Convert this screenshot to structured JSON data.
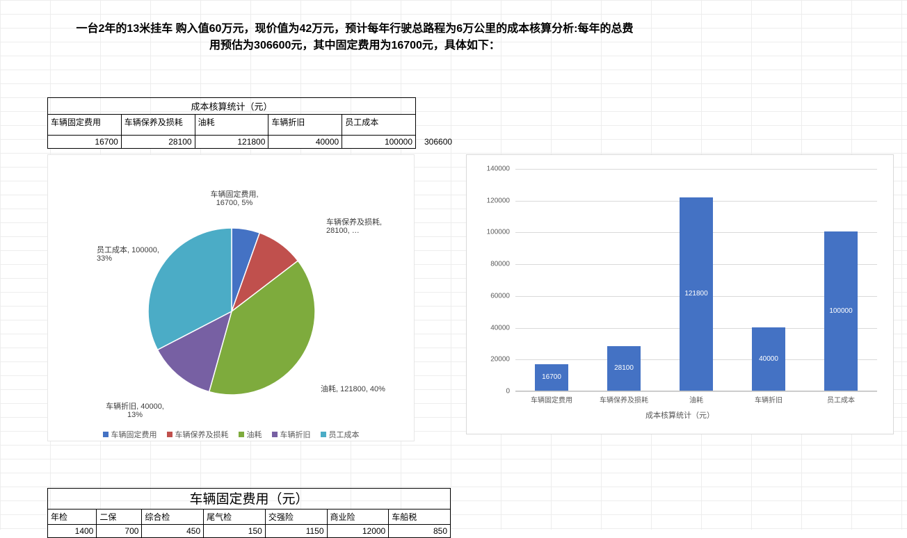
{
  "title_line1": "一台2年的13米挂车 购入值60万元，现价值为42万元，预计每年行驶总路程为6万公里的成本核算分析:每年的总费",
  "title_line2": "用预估为306600元，其中固定费用为16700元，具体如下：",
  "summary_table": {
    "title": "成本核算统计（元）",
    "headers": [
      "车辆固定费用",
      "车辆保养及损耗",
      "油耗",
      "车辆折旧",
      "员工成本"
    ],
    "values": [
      16700,
      28100,
      121800,
      40000,
      100000
    ],
    "total": 306600
  },
  "fixed_cost_table": {
    "title": "车辆固定费用（元）",
    "headers": [
      "年检",
      "二保",
      "综合检",
      "尾气检",
      "交强险",
      "商业险",
      "车船税"
    ],
    "values": [
      1400,
      700,
      450,
      150,
      1150,
      12000,
      850
    ]
  },
  "chart_data": [
    {
      "type": "pie",
      "title": "",
      "categories": [
        "车辆固定费用",
        "车辆保养及损耗",
        "油耗",
        "车辆折旧",
        "员工成本"
      ],
      "values": [
        16700,
        28100,
        121800,
        40000,
        100000
      ],
      "percentages": [
        5,
        9,
        40,
        13,
        33
      ],
      "data_labels": [
        "车辆固定费用, 16700, 5%",
        "车辆保养及损耗, 28100, …",
        "油耗, 121800, 40%",
        "车辆折旧, 40000, 13%",
        "员工成本, 100000, 33%"
      ],
      "legend_entries": [
        "车辆固定费用",
        "车辆保养及损耗",
        "油耗",
        "车辆折旧",
        "员工成本"
      ],
      "colors": [
        "#4472c4",
        "#c0504d",
        "#7EAB3D",
        "#7760A3",
        "#4bacc6"
      ]
    },
    {
      "type": "bar",
      "title": "",
      "xlabel": "成本核算统计（元）",
      "ylabel": "",
      "categories": [
        "车辆固定费用",
        "车辆保养及损耗",
        "油耗",
        "车辆折旧",
        "员工成本"
      ],
      "values": [
        16700,
        28100,
        121800,
        40000,
        100000
      ],
      "ylim": [
        0,
        140000
      ],
      "yticks": [
        0,
        20000,
        40000,
        60000,
        80000,
        100000,
        120000,
        140000
      ],
      "color": "#4472c4"
    }
  ]
}
